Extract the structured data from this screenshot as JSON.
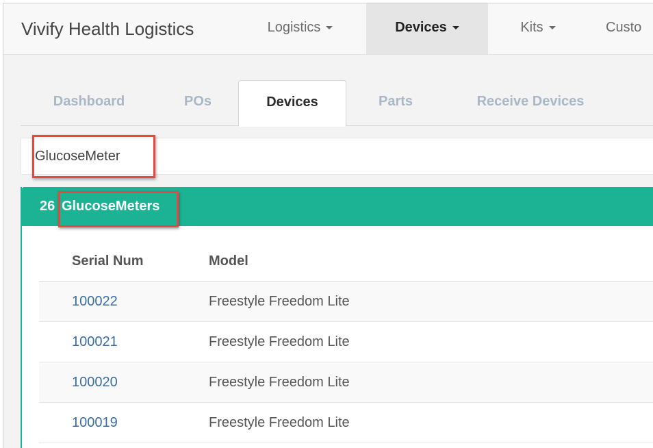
{
  "navbar": {
    "brand": "Vivify Health Logistics",
    "items": [
      {
        "label": "Logistics",
        "active": false
      },
      {
        "label": "Devices",
        "active": true
      },
      {
        "label": "Kits",
        "active": false
      },
      {
        "label": "Custo",
        "active": false
      }
    ]
  },
  "tabs": [
    {
      "label": "Dashboard"
    },
    {
      "label": "POs"
    },
    {
      "label": "Devices",
      "active": true
    },
    {
      "label": "Parts"
    },
    {
      "label": "Receive Devices"
    }
  ],
  "search": {
    "value": "GlucoseMeter"
  },
  "panel": {
    "count": "26",
    "title": "GlucoseMeters"
  },
  "table": {
    "columns": [
      "Serial Num",
      "Model"
    ],
    "rows": [
      {
        "serial": "100022",
        "model": "Freestyle Freedom Lite"
      },
      {
        "serial": "100021",
        "model": "Freestyle Freedom Lite"
      },
      {
        "serial": "100020",
        "model": "Freestyle Freedom Lite"
      },
      {
        "serial": "100019",
        "model": "Freestyle Freedom Lite"
      }
    ]
  },
  "colors": {
    "accent": "#1bb394",
    "highlight": "#e8473f",
    "link": "#3a6ea5"
  },
  "icons": [
    "caret-down-icon"
  ]
}
